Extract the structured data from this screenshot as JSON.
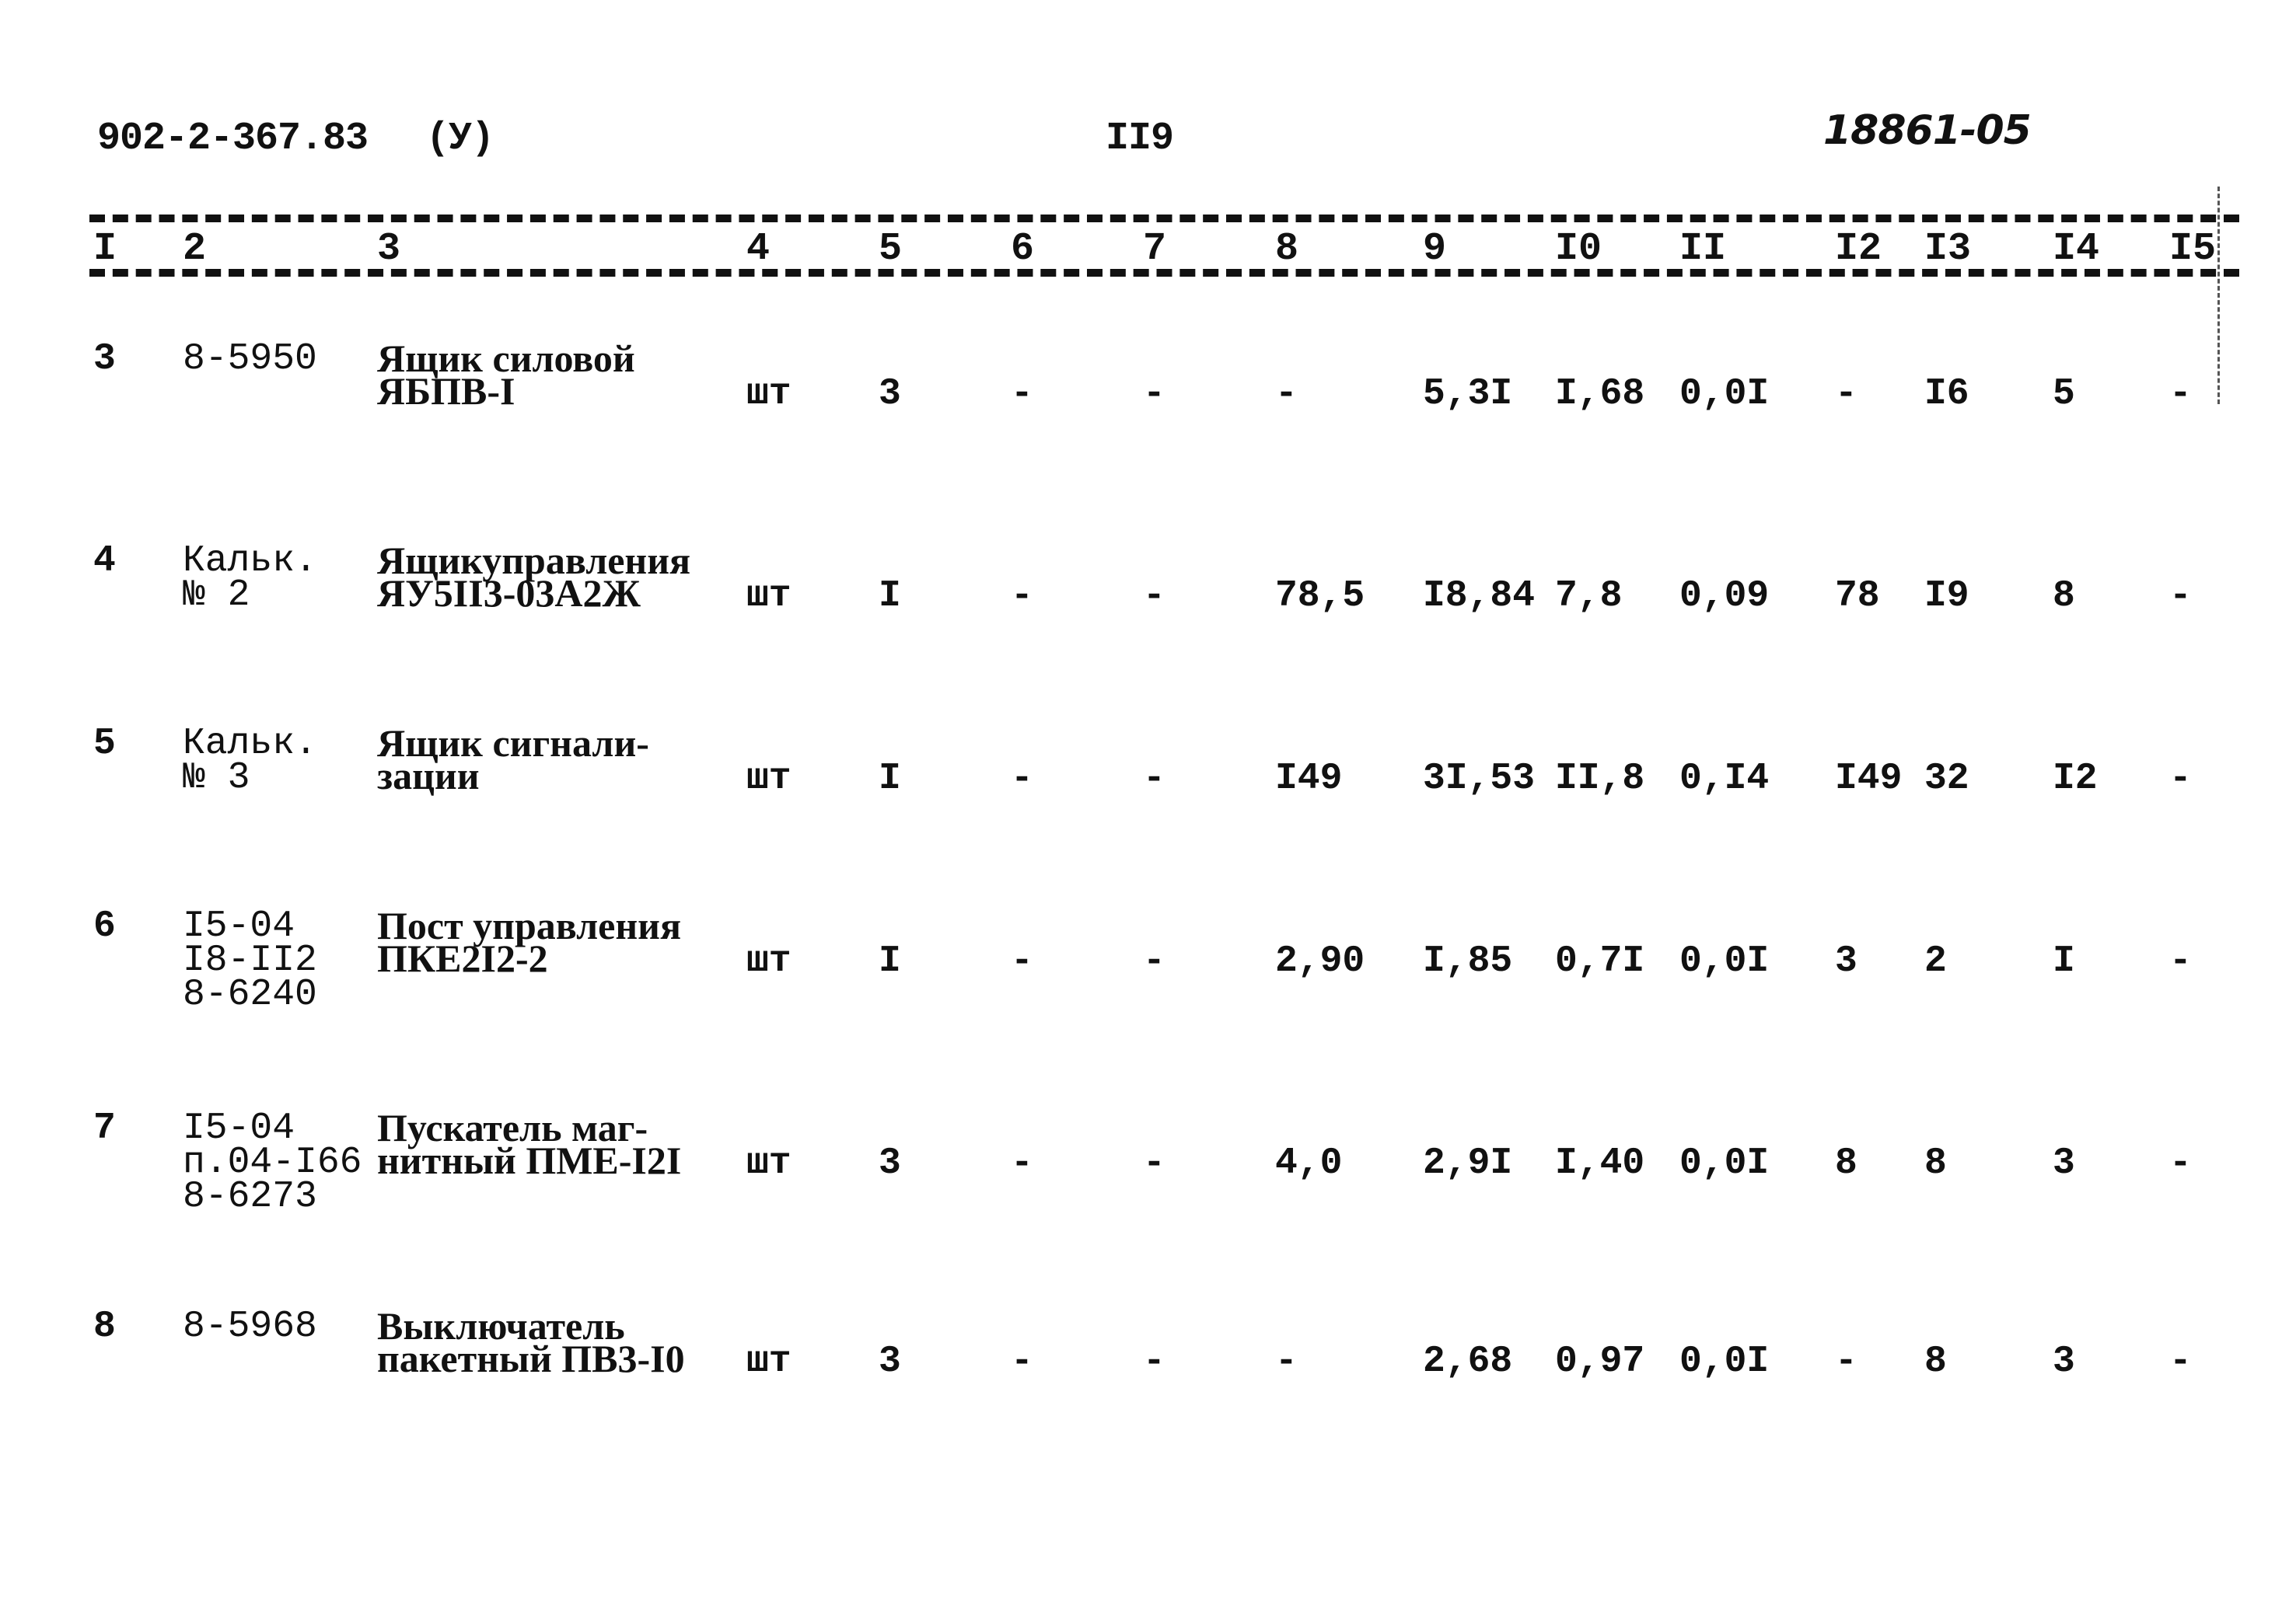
{
  "header": {
    "doc_code": "902-2-367.83",
    "doc_suffix": "(У)",
    "page_number": "II9",
    "stamp": "18861-05"
  },
  "columns": [
    "I",
    "2",
    "3",
    "4",
    "5",
    "6",
    "7",
    "8",
    "9",
    "I0",
    "II",
    "I2",
    "I3",
    "I4",
    "I5"
  ],
  "rows": [
    {
      "c1": "3",
      "c2": "8-5950",
      "c3": "Ящик силовой\nЯБПВ-I",
      "c4": "шт",
      "c5": "3",
      "c6": "-",
      "c7": "-",
      "c8": "-",
      "c9": "5,3I",
      "c10": "I,68",
      "c11": "0,0I",
      "c12": "-",
      "c13": "I6",
      "c14": "5",
      "c15": "-"
    },
    {
      "c1": "4",
      "c2": "Кальк.\n№ 2",
      "c3": "Ящикуправления\nЯУ5II3-03А2Ж",
      "c4": "шт",
      "c5": "I",
      "c6": "-",
      "c7": "-",
      "c8": "78,5",
      "c9": "I8,84",
      "c10": "7,8",
      "c11": "0,09",
      "c12": "78",
      "c13": "I9",
      "c14": "8",
      "c15": "-"
    },
    {
      "c1": "5",
      "c2": "Кальк.\n№ 3",
      "c3": "Ящик сигнали-\nзации",
      "c4": "шт",
      "c5": "I",
      "c6": "-",
      "c7": "-",
      "c8": "I49",
      "c9": "3I,53",
      "c10": "II,8",
      "c11": "0,I4",
      "c12": "I49",
      "c13": "32",
      "c14": "I2",
      "c15": "-"
    },
    {
      "c1": "6",
      "c2": "I5-04\nI8-II2\n8-6240",
      "c3": "Пост управления\nПКЕ2I2-2",
      "c4": "шт",
      "c5": "I",
      "c6": "-",
      "c7": "-",
      "c8": "2,90",
      "c9": "I,85",
      "c10": "0,7I",
      "c11": "0,0I",
      "c12": "3",
      "c13": "2",
      "c14": "I",
      "c15": "-"
    },
    {
      "c1": "7",
      "c2": "I5-04\nп.04-I66\n8-6273",
      "c3": "Пускатель маг-\nнитный ПМЕ-I2I",
      "c4": "шт",
      "c5": "3",
      "c6": "-",
      "c7": "-",
      "c8": "4,0",
      "c9": "2,9I",
      "c10": "I,40",
      "c11": "0,0I",
      "c12": "8",
      "c13": "8",
      "c14": "3",
      "c15": "-"
    },
    {
      "c1": "8",
      "c2": "8-5968",
      "c3": "Выключатель\nпакетный ПВ3-I0",
      "c4": "шт",
      "c5": "3",
      "c6": "-",
      "c7": "-",
      "c8": "-",
      "c9": "2,68",
      "c10": "0,97",
      "c11": "0,0I",
      "c12": "-",
      "c13": "8",
      "c14": "3",
      "c15": "-"
    }
  ]
}
